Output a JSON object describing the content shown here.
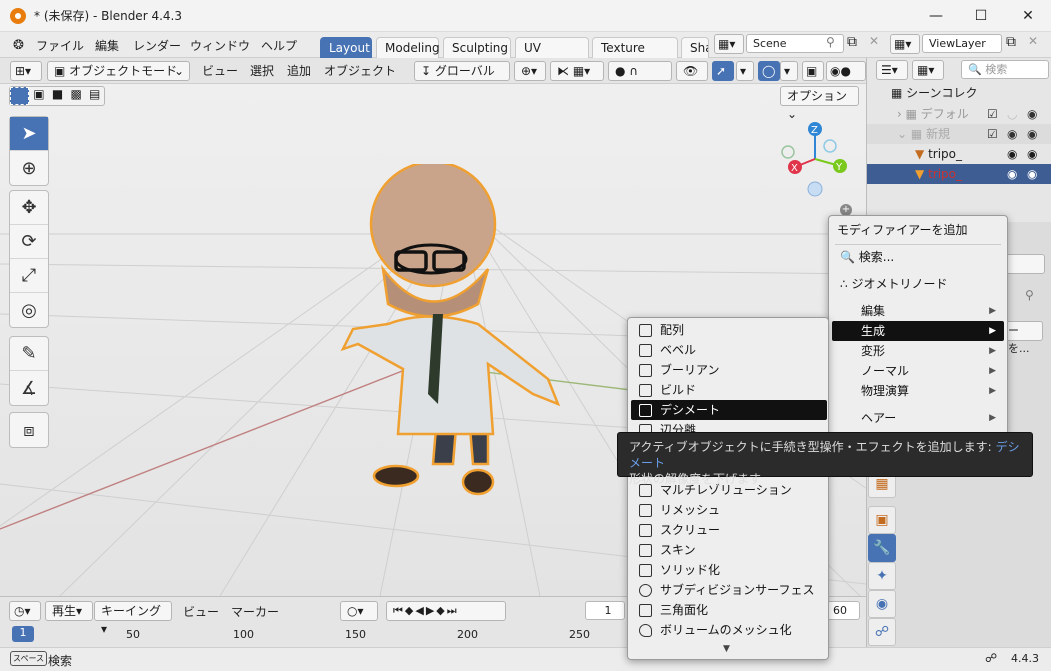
{
  "window": {
    "title": "* (未保存) - Blender 4.4.3"
  },
  "topmenu": [
    "ファイル",
    "編集",
    "レンダー",
    "ウィンドウ",
    "ヘルプ"
  ],
  "workspace_tabs": [
    "Layout",
    "Modeling",
    "Sculpting",
    "UV Editing",
    "Texture Paint",
    "Sha"
  ],
  "scene_field": "Scene",
  "viewlayer_field": "ViewLayer",
  "vheader": {
    "mode": "オブジェクトモード",
    "view": "ビュー",
    "select": "選択",
    "add": "追加",
    "object": "オブジェクト",
    "orientation": "グローバル",
    "options": "オプション"
  },
  "outliner": {
    "search_placeholder": "検索",
    "collection": "シーンコレク",
    "items": [
      "デフォル",
      "新規",
      "tripo_",
      "tripo_"
    ]
  },
  "modifier_menu": {
    "title": "モディファイアーを追加",
    "search": "検索...",
    "geometry": "ジオメトリノード",
    "categories": [
      "編集",
      "生成",
      "変形",
      "ノーマル",
      "物理演算",
      "ヘアー"
    ]
  },
  "generate_menu": [
    "配列",
    "ベベル",
    "ブーリアン",
    "ビルド",
    "デシメート",
    "辺分離",
    "",
    "マルチレゾリューション",
    "リメッシュ",
    "スクリュー",
    "スキン",
    "ソリッド化",
    "サブディビジョンサーフェス",
    "三角面化",
    "ボリュームのメッシュ化"
  ],
  "tooltip": {
    "line1": "アクティブオブジェクトに手続き型操作・エフェクトを追加します:",
    "link": "デシメート",
    "line2": "形状の解像度を下げます"
  },
  "props_button": "ーを...",
  "timeline": {
    "play": "再生",
    "keying": "キーイング",
    "view": "ビュー",
    "marker": "マーカー",
    "current_frame": "1",
    "start_frame": "1",
    "end_frame": "60",
    "ticks": [
      "50",
      "100",
      "150",
      "200",
      "250"
    ]
  },
  "statusbar": {
    "key": "スペース",
    "label": "検索",
    "version": "4.4.3"
  },
  "colors": {
    "accent": "#4772b3",
    "axis_x": "#e0344b",
    "axis_y": "#7ac91c",
    "axis_z": "#2e86d4",
    "selected_outline": "#f0a030"
  }
}
